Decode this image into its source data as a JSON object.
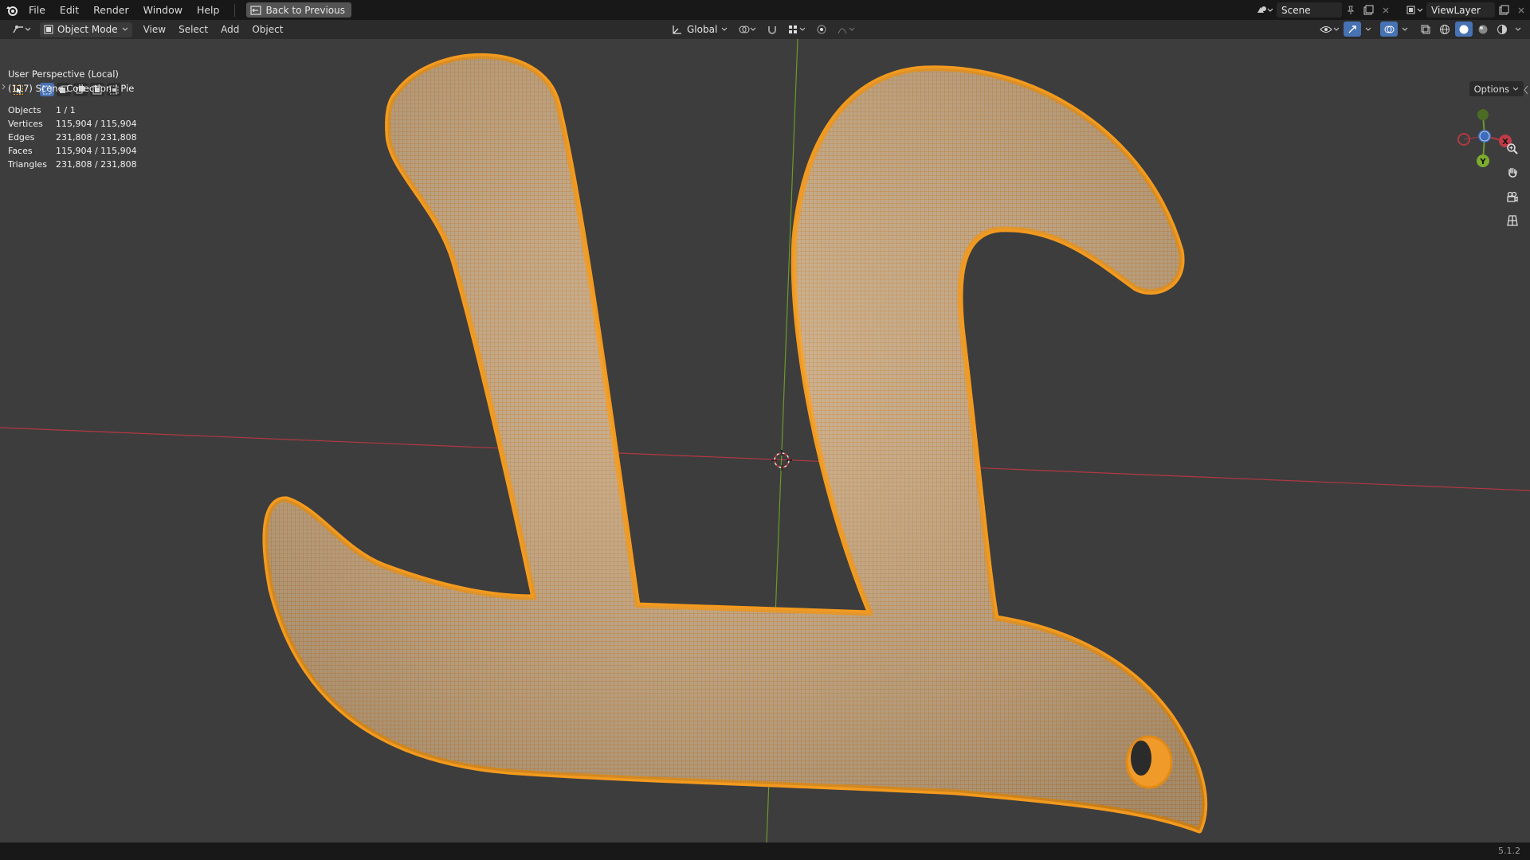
{
  "topbar": {
    "menu": [
      "File",
      "Edit",
      "Render",
      "Window",
      "Help"
    ],
    "back_button": "Back to Previous",
    "scene": "Scene",
    "view_layer": "ViewLayer"
  },
  "header": {
    "mode": "Object Mode",
    "menus": [
      "View",
      "Select",
      "Add",
      "Object"
    ],
    "orientation": "Global",
    "options": "Options"
  },
  "overlay": {
    "view_name": "User Perspective (Local)",
    "collection": "(117) Scene Collection | Pie"
  },
  "stats": [
    {
      "key": "Objects",
      "value": "1 / 1"
    },
    {
      "key": "Vertices",
      "value": "115,904 / 115,904"
    },
    {
      "key": "Edges",
      "value": "231,808 / 231,808"
    },
    {
      "key": "Faces",
      "value": "115,904 / 115,904"
    },
    {
      "key": "Triangles",
      "value": "231,808 / 231,808"
    }
  ],
  "gizmo": {
    "x_label": "X",
    "y_label": "Y"
  },
  "status": {
    "version": "5.1.2"
  },
  "colors": {
    "selection": "#f39a1e",
    "axis_x": "#c23b48",
    "axis_y": "#6e9f2b",
    "background": "#3d3d3d"
  }
}
